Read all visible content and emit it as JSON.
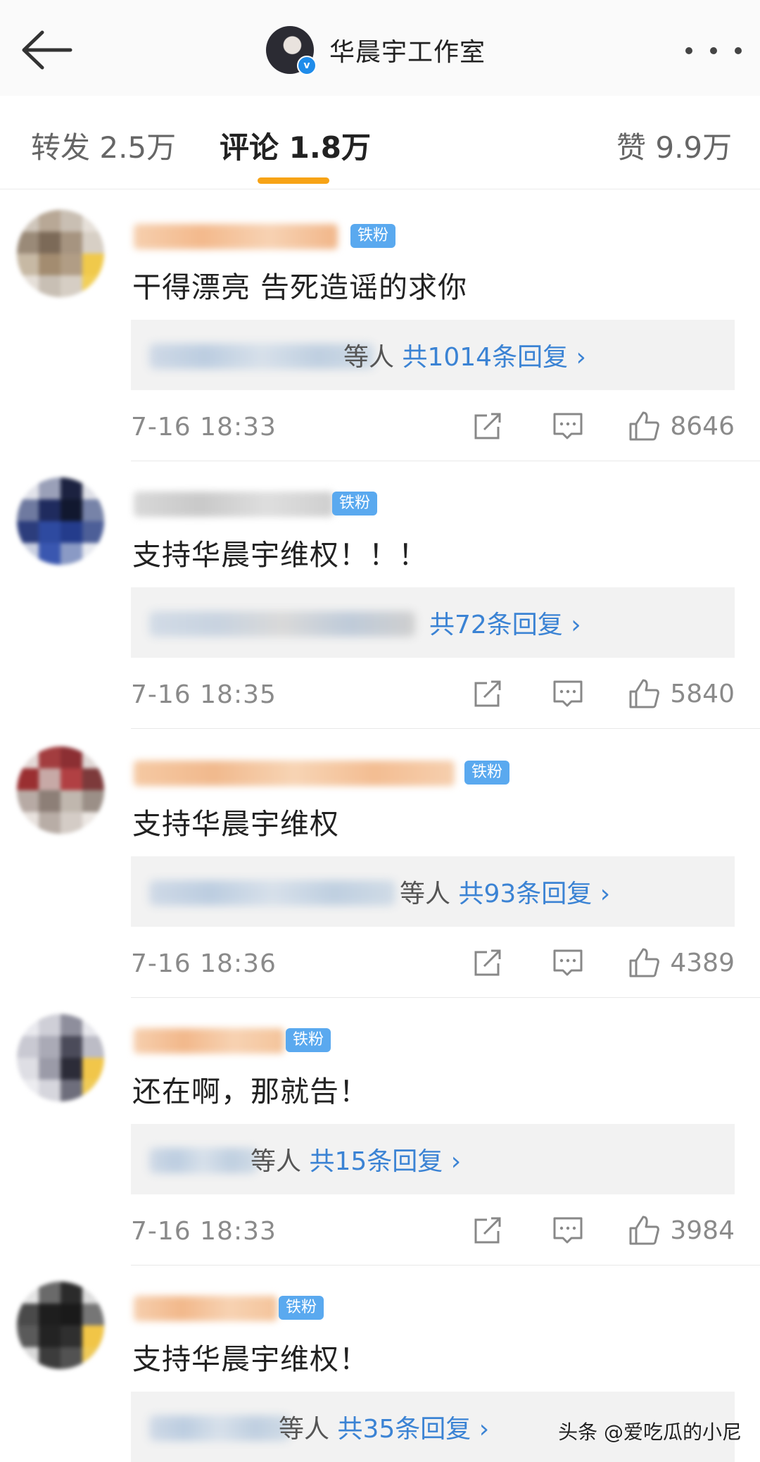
{
  "header": {
    "title": "华晨宇工作室",
    "verified_mark": "v"
  },
  "tabs": [
    {
      "label": "转发 2.5万"
    },
    {
      "label": "评论 1.8万"
    },
    {
      "label": "赞 9.9万"
    }
  ],
  "comments": [
    {
      "badge": "铁粉",
      "text": "干得漂亮 告死造谣的求你",
      "reply_prefix": "等人",
      "reply_count": "共1014条回复 ›",
      "time": "7-16 18:33",
      "likes": "8646"
    },
    {
      "badge": "铁粉",
      "text": "支持华晨宇维权！！！",
      "reply_prefix": "",
      "reply_count": "共72条回复 ›",
      "time": "7-16 18:35",
      "likes": "5840"
    },
    {
      "badge": "铁粉",
      "text": "支持华晨宇维权",
      "reply_prefix": "等人",
      "reply_count": "共93条回复 ›",
      "time": "7-16 18:36",
      "likes": "4389"
    },
    {
      "badge": "铁粉",
      "text": "还在啊，那就告！",
      "reply_prefix": "等人",
      "reply_count": "共15条回复 ›",
      "time": "7-16 18:33",
      "likes": "3984"
    },
    {
      "badge": "铁粉",
      "text": "支持华晨宇维权！",
      "reply_prefix": "等人",
      "reply_count": "共35条回复 ›",
      "time": "",
      "likes": ""
    }
  ],
  "watermark": "头条 @爱吃瓜的小尼",
  "icons": [
    "back-arrow-icon",
    "more-dots-icon",
    "repost-icon",
    "comment-icon",
    "like-icon"
  ]
}
